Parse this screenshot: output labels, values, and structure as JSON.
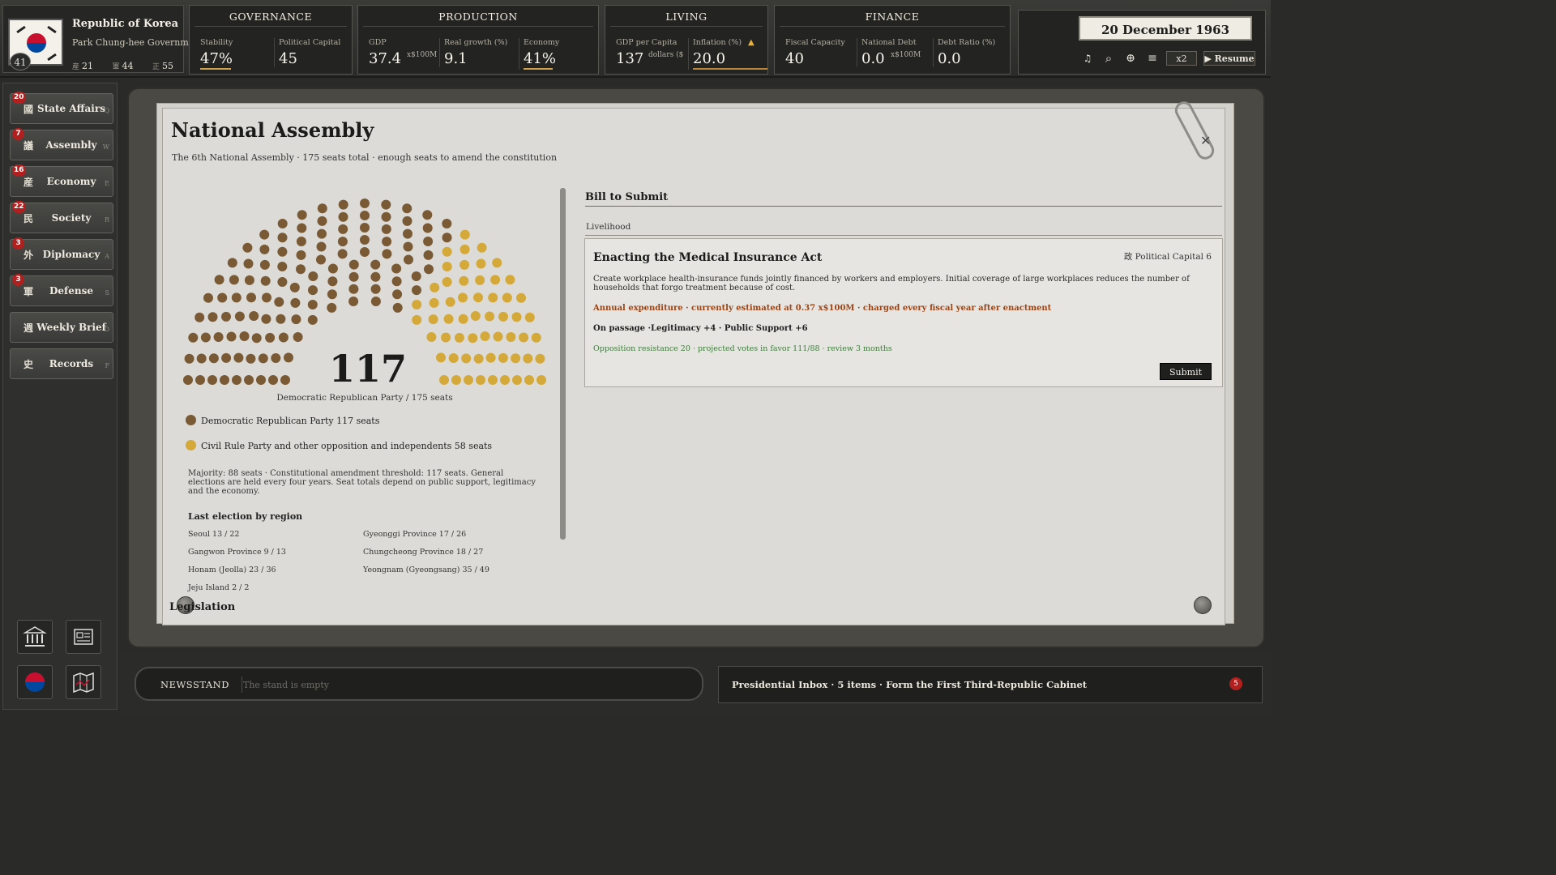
{
  "nation": {
    "name": "Republic of Korea",
    "government": "Park Chung-hee Government",
    "leader_age": "41",
    "stats": [
      {
        "key": "産",
        "value": "21"
      },
      {
        "key": "軍",
        "value": "44"
      },
      {
        "key": "正",
        "value": "55"
      }
    ]
  },
  "governance": {
    "title": "GOVERNANCE",
    "stability_label": "Stability",
    "stability_value": "47%",
    "capital_label": "Political Capital",
    "capital_value": "45"
  },
  "production": {
    "title": "PRODUCTION",
    "gdp_label": "GDP",
    "gdp_value": "37.4",
    "gdp_unit": "x$100M",
    "growth_label": "Real growth (%)",
    "growth_value": "9.1",
    "economy_label": "Economy",
    "economy_value": "41%"
  },
  "living": {
    "title": "LIVING",
    "gdppc_label": "GDP per Capita",
    "gdppc_value": "137",
    "gdppc_unit": "dollars ($",
    "inflation_label": "Inflation (%)",
    "inflation_value": "20.0",
    "inflation_warn": "▲"
  },
  "finance": {
    "title": "FINANCE",
    "fiscal_label": "Fiscal Capacity",
    "fiscal_value": "40",
    "debt_label": "National Debt",
    "debt_value": "0.0",
    "debt_unit": "x$100M",
    "ratio_label": "Debt Ratio (%)",
    "ratio_value": "0.0"
  },
  "controls": {
    "date": "20 December 1963",
    "music_icon": "♫",
    "search_icon": "⌕",
    "settings_icon": "⊕",
    "menu_icon": "≡",
    "speed": "x2",
    "resume": "▶ Resume"
  },
  "sidebar": {
    "items": [
      {
        "icon": "國",
        "label": "State Affairs",
        "key": "Q",
        "badge": "20"
      },
      {
        "icon": "議",
        "label": "Assembly",
        "key": "W",
        "badge": "7"
      },
      {
        "icon": "産",
        "label": "Economy",
        "key": "E",
        "badge": "16"
      },
      {
        "icon": "民",
        "label": "Society",
        "key": "R",
        "badge": "22"
      },
      {
        "icon": "外",
        "label": "Diplomacy",
        "key": "A",
        "badge": "3"
      },
      {
        "icon": "軍",
        "label": "Defense",
        "key": "S",
        "badge": "3"
      },
      {
        "icon": "週",
        "label": "Weekly Brief",
        "key": "D",
        "badge": ""
      },
      {
        "icon": "史",
        "label": "Records",
        "key": "F",
        "badge": ""
      }
    ]
  },
  "assembly": {
    "title": "National Assembly",
    "subtitle": "The 6th National Assembly · 175 seats total · enough seats to amend the constitution",
    "majority_count": "117",
    "majority_caption": "Democratic Republican Party / 175 seats",
    "seats": {
      "total": 175,
      "ruling": 117,
      "opposition": 58
    },
    "colors": {
      "ruling": "#7a5a35",
      "opposition": "#d4a93a"
    },
    "legend": [
      {
        "label": "Democratic Republican Party 117 seats"
      },
      {
        "label": "Civil Rule Party and other opposition and independents 58 seats"
      }
    ],
    "majority_note": "Majority: 88 seats · Constitutional amendment threshold: 117 seats. General elections are held every four years. Seat totals depend on public support, legitimacy and the economy.",
    "last_election_title": "Last election by region",
    "regions": [
      {
        "name": "Seoul  13 / 22"
      },
      {
        "name": "Gyeonggi Province  17 / 26"
      },
      {
        "name": "Gangwon Province  9 / 13"
      },
      {
        "name": "Chungcheong Province  18 / 27"
      },
      {
        "name": "Honam (Jeolla)  23 / 36"
      },
      {
        "name": "Yeongnam (Gyeongsang)  35 / 49"
      },
      {
        "name": "Jeju Island  2 / 2"
      }
    ],
    "legislation_label": "Legislation"
  },
  "bill": {
    "section_title": "Bill to Submit",
    "category": "Livelihood",
    "name": "Enacting the Medical Insurance Act",
    "cost": "政 Political Capital 6",
    "description": "Create workplace health-insurance funds jointly financed by workers and employers. Initial coverage of large workplaces reduces the number of households that forgo treatment because of cost.",
    "expenditure": "Annual expenditure · currently estimated at 0.37 x$100M · charged every fiscal year after enactment",
    "on_passage": "On passage ·Legitimacy +4 · Public Support +6",
    "opposition": "Opposition resistance 20 · projected votes in favor 111/88 · review 3 months",
    "submit_label": "Submit"
  },
  "bottom": {
    "newsstand_label": "NEWSSTAND",
    "newsstand_value": "The stand is empty",
    "inbox_text": "Presidential Inbox · 5 items · Form the First Third-Republic Cabinet",
    "inbox_count": "5"
  }
}
